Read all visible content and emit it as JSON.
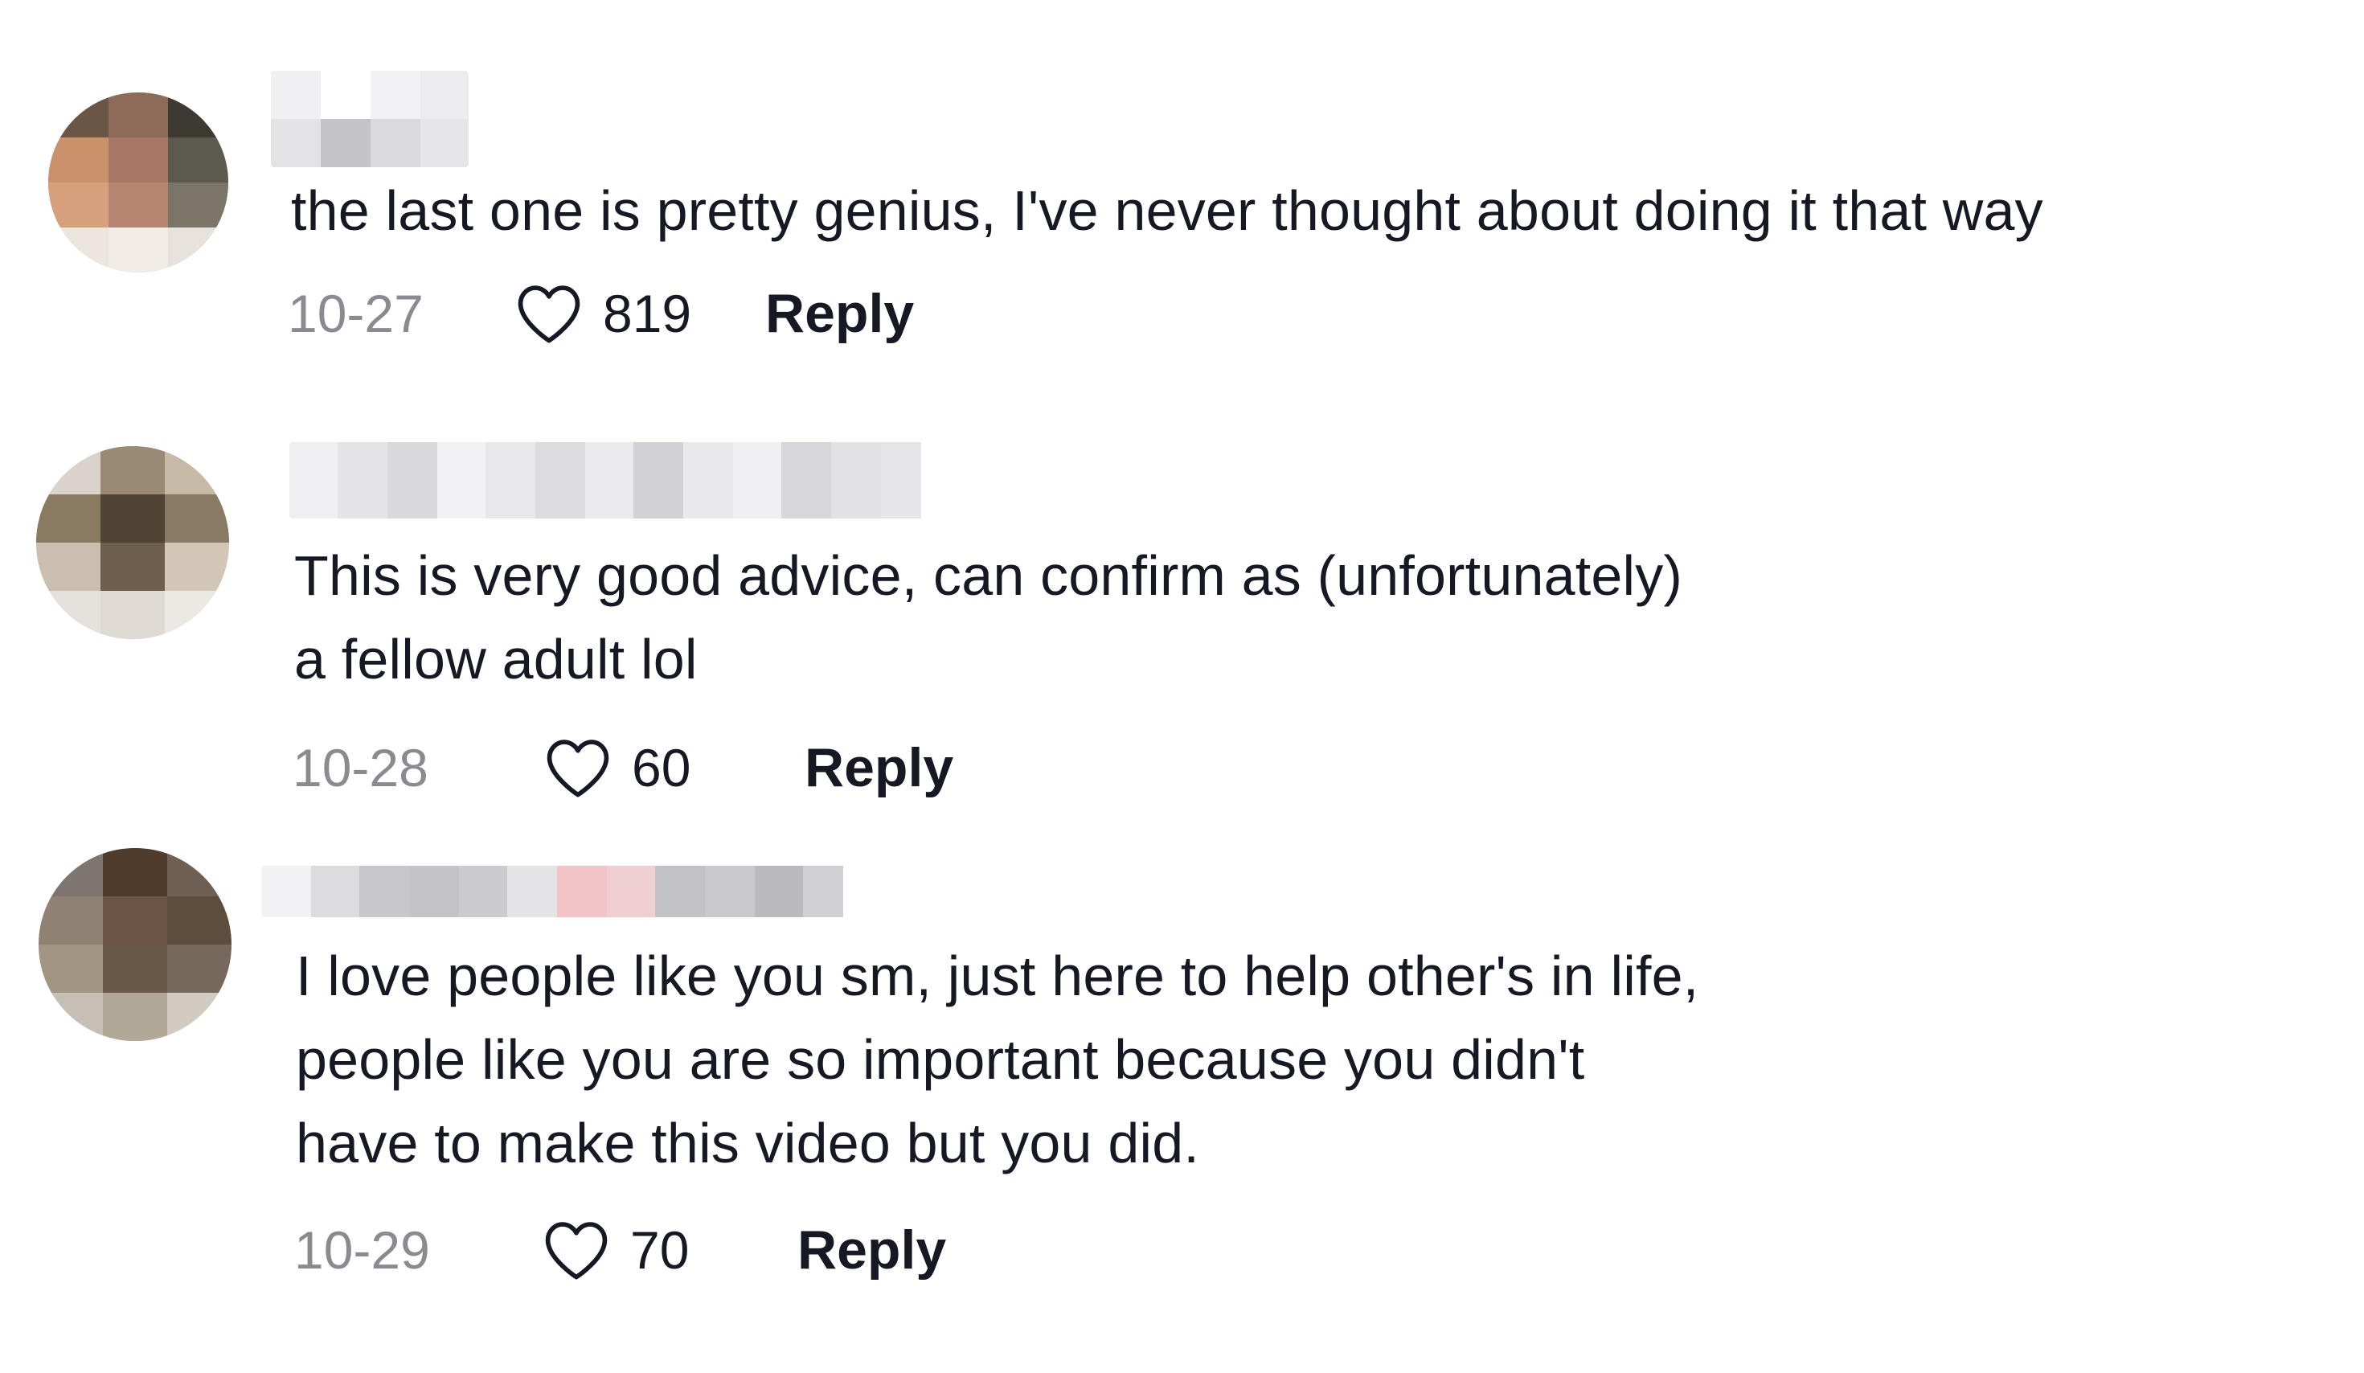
{
  "comments": [
    {
      "text": "the last one is pretty genius, I've never thought about doing it that way",
      "date": "10-27",
      "likes": "819",
      "reply_label": "Reply"
    },
    {
      "text": "This is very good advice, can confirm as (unfortunately)\na fellow adult lol",
      "date": "10-28",
      "likes": "60",
      "reply_label": "Reply"
    },
    {
      "text": "I love people like you sm, just here to help other's in life,\npeople like you are so important because you didn't\nhave to make this video but you did.",
      "date": "10-29",
      "likes": "70",
      "reply_label": "Reply"
    }
  ],
  "icons": {
    "like": "heart-outline-icon"
  }
}
